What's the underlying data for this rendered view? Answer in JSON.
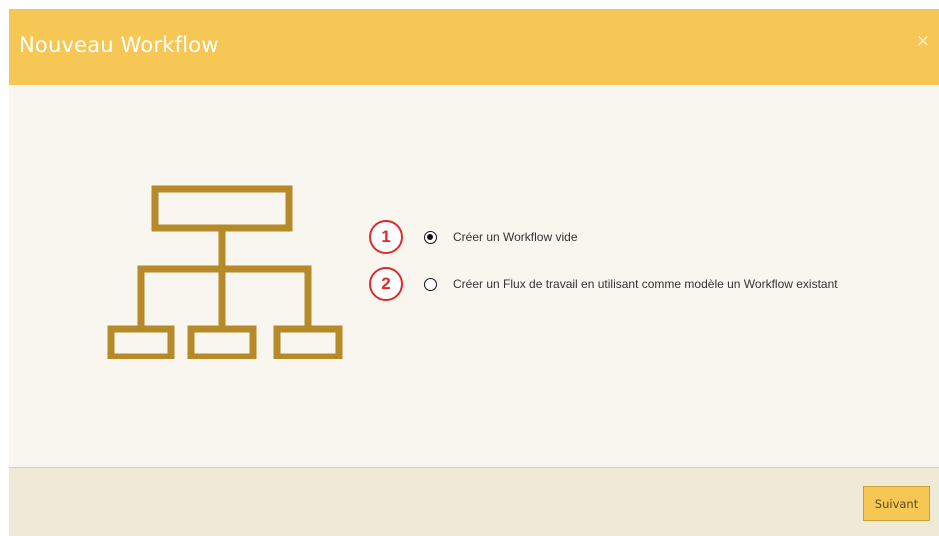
{
  "dialog": {
    "title": "Nouveau Workflow",
    "close_icon": "close-icon",
    "close_label": "×"
  },
  "illustration": {
    "icon": "workflow-hierarchy-icon",
    "color": "#b68a28"
  },
  "options": [
    {
      "step": "1",
      "label": "Créer un Workflow vide",
      "selected": true
    },
    {
      "step": "2",
      "label": "Créer un Flux de travail en utilisant comme modèle un Workflow existant",
      "selected": false
    }
  ],
  "footer": {
    "next_label": "Suivant"
  },
  "colors": {
    "header": "#f6c755",
    "body": "#f8f6ef",
    "footer": "#efe9d8",
    "annotation": "#e02a2a",
    "accent": "#b68a28"
  }
}
